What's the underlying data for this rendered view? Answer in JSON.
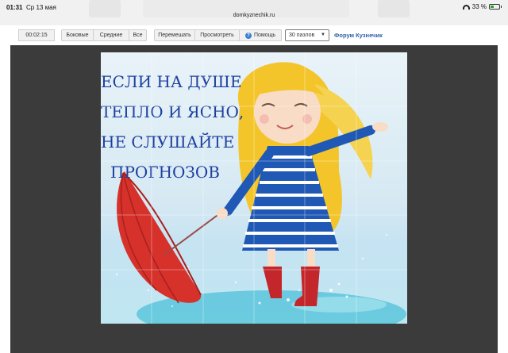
{
  "status_bar": {
    "time": "01:31",
    "date": "Ср 13 мая",
    "url": "domkyznechik.ru",
    "battery": "33 %"
  },
  "toolbar": {
    "timer": "00:02:15",
    "side_label": "Боковые",
    "middle_label": "Средние",
    "all_label": "Все",
    "shuffle_label": "Перемешать",
    "view_label": "Просмотреть",
    "help_label": "Помощь",
    "pieces_select": "30 пазлов",
    "forum_link": "Форум Кузнечик"
  },
  "puzzle": {
    "quote_lines": [
      "ЕСЛИ НА ДУШЕ",
      "ТЕПЛО И ЯСНО,",
      "НЕ СЛУШАЙТЕ",
      "ПРОГНОЗОВ"
    ],
    "colors": {
      "board": "#3b3b3b",
      "text": "#1d3fa0",
      "umbrella": "#d6312b",
      "hair": "#f3c52a",
      "dress": "#1f58b5",
      "boots": "#c4272b",
      "water": "#5cc6dc"
    }
  }
}
